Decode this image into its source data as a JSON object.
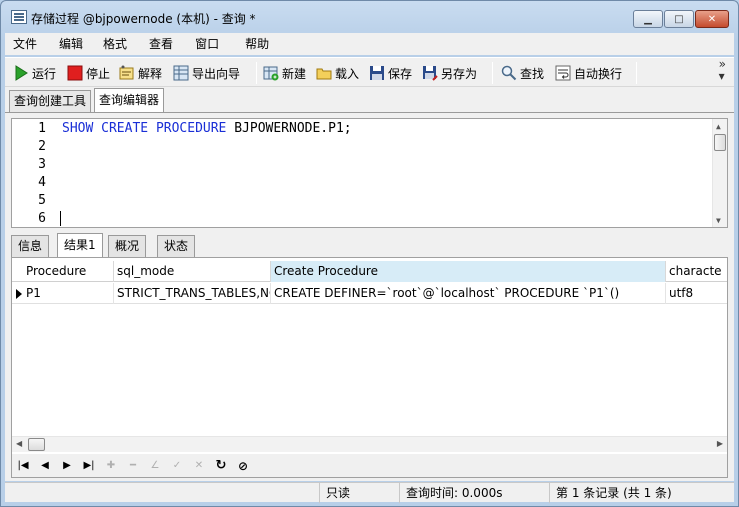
{
  "window": {
    "title": "存储过程 @bjpowernode (本机) - 查询 *"
  },
  "menu": [
    "文件",
    "编辑",
    "格式",
    "查看",
    "窗口",
    "帮助"
  ],
  "toolbar": {
    "run": "运行",
    "stop": "停止",
    "explain": "解释",
    "export": "导出向导",
    "new": "新建",
    "load": "载入",
    "save": "保存",
    "save_as": "另存为",
    "find": "查找",
    "wrap": "自动换行"
  },
  "tabs": {
    "builder": "查询创建工具",
    "editor": "查询编辑器"
  },
  "editor": {
    "line_numbers": [
      "1",
      "2",
      "3",
      "4",
      "5",
      "6"
    ],
    "keywords": [
      "SHOW",
      "CREATE",
      "PROCEDURE"
    ],
    "rest": " BJPOWERNODE.P1;"
  },
  "result_tabs": [
    "信息",
    "结果1",
    "概况",
    "状态"
  ],
  "grid": {
    "columns": [
      "Procedure",
      "sql_mode",
      "Create Procedure",
      "characte"
    ],
    "rows": [
      [
        "P1",
        "STRICT_TRANS_TABLES,NO",
        "CREATE DEFINER=`root`@`localhost` PROCEDURE `P1`()",
        "utf8"
      ]
    ]
  },
  "status": {
    "readonly": "只读",
    "query_time": "查询时间: 0.000s",
    "records": "第 1 条记录 (共 1 条)"
  }
}
